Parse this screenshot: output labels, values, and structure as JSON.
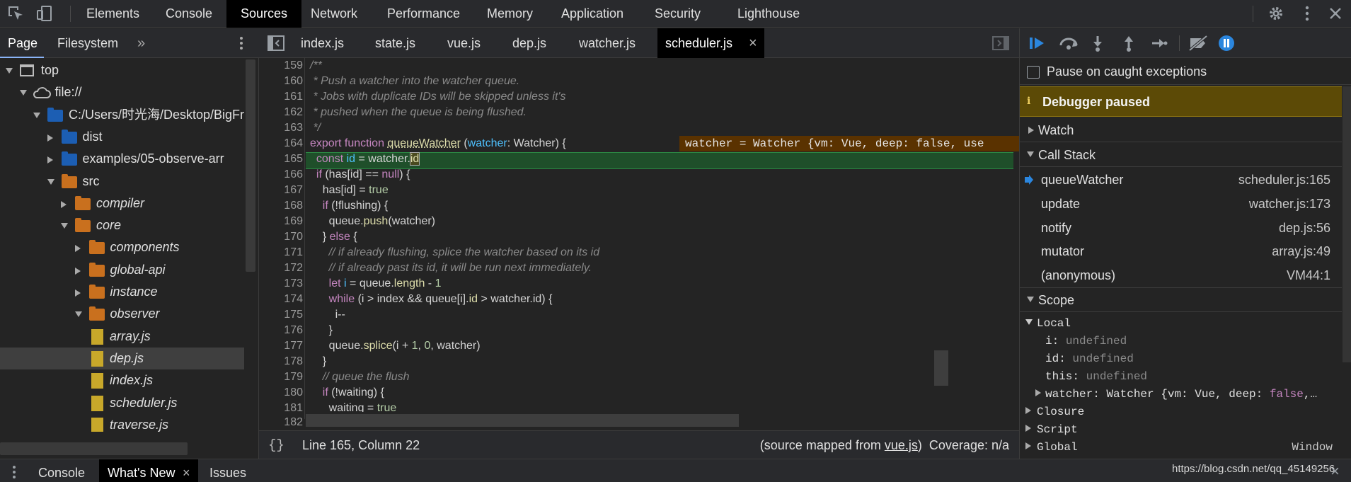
{
  "toolbar": {
    "tabs": [
      "Elements",
      "Console",
      "Sources",
      "Network",
      "Performance",
      "Memory",
      "Application",
      "Security",
      "Lighthouse"
    ],
    "active_tab": "Sources"
  },
  "navigator": {
    "tabs": [
      "Page",
      "Filesystem"
    ],
    "more": "»",
    "tree": [
      {
        "label": "top",
        "depth": 0,
        "kind": "frame",
        "open": true
      },
      {
        "label": "file://",
        "depth": 1,
        "kind": "cloud",
        "open": true
      },
      {
        "label": "C:/Users/时光海/Desktop/BigFr",
        "depth": 2,
        "kind": "folder-blue",
        "open": true
      },
      {
        "label": "dist",
        "depth": 3,
        "kind": "folder-blue",
        "open": false
      },
      {
        "label": "examples/05-observe-arr",
        "depth": 3,
        "kind": "folder-blue",
        "open": false
      },
      {
        "label": "src",
        "depth": 3,
        "kind": "folder-orange",
        "open": true
      },
      {
        "label": "compiler",
        "depth": 4,
        "kind": "folder-orange",
        "open": false
      },
      {
        "label": "core",
        "depth": 4,
        "kind": "folder-orange",
        "open": true
      },
      {
        "label": "components",
        "depth": 5,
        "kind": "folder-orange",
        "open": false
      },
      {
        "label": "global-api",
        "depth": 5,
        "kind": "folder-orange",
        "open": false
      },
      {
        "label": "instance",
        "depth": 5,
        "kind": "folder-orange",
        "open": false
      },
      {
        "label": "observer",
        "depth": 5,
        "kind": "folder-orange",
        "open": true
      },
      {
        "label": "array.js",
        "depth": 6,
        "kind": "file"
      },
      {
        "label": "dep.js",
        "depth": 6,
        "kind": "file",
        "selected": true
      },
      {
        "label": "index.js",
        "depth": 6,
        "kind": "file"
      },
      {
        "label": "scheduler.js",
        "depth": 6,
        "kind": "file"
      },
      {
        "label": "traverse.js",
        "depth": 6,
        "kind": "file"
      }
    ]
  },
  "editor": {
    "tabs": [
      "index.js",
      "state.js",
      "vue.js",
      "dep.js",
      "watcher.js",
      "scheduler.js"
    ],
    "active_tab": "scheduler.js",
    "close": "×",
    "inline_value": "watcher = Watcher {vm: Vue, deep: false, use",
    "status_position": "Line 165, Column 22",
    "status_source_prefix": "(source mapped from ",
    "status_source_link": "vue.js",
    "status_source_suffix": ")",
    "status_coverage": "Coverage: n/a",
    "format_icon": "{}"
  },
  "debugger": {
    "pause_caught_label": "Pause on caught exceptions",
    "paused_banner": "Debugger paused",
    "watch_label": "Watch",
    "callstack_label": "Call Stack",
    "callstack": [
      {
        "fn": "queueWatcher",
        "loc": "scheduler.js:165",
        "current": true
      },
      {
        "fn": "update",
        "loc": "watcher.js:173"
      },
      {
        "fn": "notify",
        "loc": "dep.js:56"
      },
      {
        "fn": "mutator",
        "loc": "array.js:49"
      },
      {
        "fn": "(anonymous)",
        "loc": "VM44:1"
      }
    ],
    "scope_label": "Scope",
    "local_label": "Local",
    "locals": [
      {
        "name": "i",
        "value": "undefined"
      },
      {
        "name": "id",
        "value": "undefined"
      },
      {
        "name": "this",
        "value": "undefined"
      }
    ],
    "watcher_name": "watcher",
    "watcher_value_a": "Watcher {vm: Vue, deep: ",
    "watcher_value_b": "false",
    "watcher_value_c": ",…",
    "closure_label": "Closure",
    "script_label": "Script",
    "global_label": "Global",
    "global_value": "Window"
  },
  "drawer": {
    "tabs": [
      "Console",
      "What's New",
      "Issues"
    ],
    "active_tab": "What's New",
    "close": "×"
  },
  "watermark": "https://blog.csdn.net/qq_45149256",
  "colors": {
    "paused_banner_bg": "#5c4a06",
    "current_line_bg": "#1f4f2a",
    "inline_value_bg": "#5a3200",
    "accent_blue": "#2b86de",
    "folder_blue": "#1c5eb3",
    "folder_orange": "#c9701e",
    "file_yellow": "#c8a82a"
  }
}
